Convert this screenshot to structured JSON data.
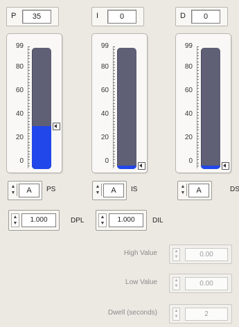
{
  "controllers": [
    {
      "id": "p",
      "header": {
        "label": "P",
        "value": "35"
      },
      "level": 35,
      "ticks": [
        "99",
        "80",
        "60",
        "40",
        "20",
        "0"
      ],
      "selector": {
        "value": "A",
        "name": "PS"
      }
    },
    {
      "id": "i",
      "header": {
        "label": "I",
        "value": "0"
      },
      "level": 0,
      "ticks": [
        "99",
        "80",
        "60",
        "40",
        "20",
        "0"
      ],
      "selector": {
        "value": "A",
        "name": "IS"
      }
    },
    {
      "id": "d",
      "header": {
        "label": "D",
        "value": "0"
      },
      "level": 0,
      "ticks": [
        "99",
        "80",
        "60",
        "40",
        "20",
        "0"
      ],
      "selector": {
        "value": "A",
        "name": "DS"
      }
    }
  ],
  "limits": {
    "dpl": {
      "value": "1.000",
      "label": "DPL"
    },
    "dil": {
      "value": "1.000",
      "label": "DIL"
    }
  },
  "params": [
    {
      "label": "High Value",
      "value": "0.00"
    },
    {
      "label": "Low Value",
      "value": "0.00"
    },
    {
      "label": "Dwell (seconds)",
      "value": "2"
    }
  ],
  "colors": {
    "fill": "#2146e9",
    "tube": "#5f6076",
    "disabled_text": "#9b9b9b"
  }
}
